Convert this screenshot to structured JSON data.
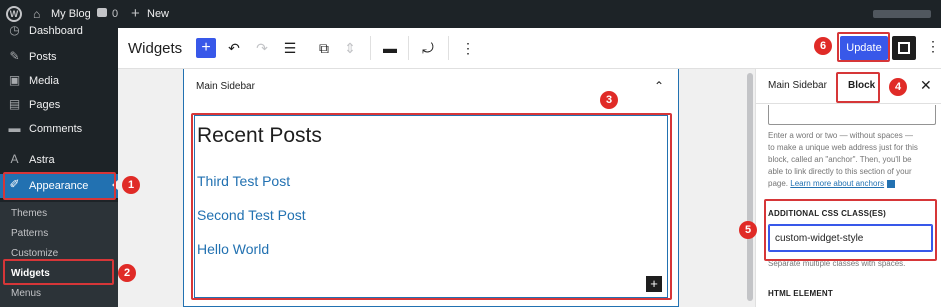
{
  "adminbar": {
    "site_name": "My Blog",
    "comment_count": "0",
    "new_label": "New",
    "wp_logo_glyph": "W",
    "home_glyph": "⌂",
    "plus_glyph": "+"
  },
  "sidebar": {
    "items": [
      {
        "label": "Dashboard",
        "icon": "dashboard-icon",
        "glyph": "◷"
      },
      {
        "label": "Posts",
        "icon": "pin-icon",
        "glyph": "✎"
      },
      {
        "label": "Media",
        "icon": "media-icon",
        "glyph": "▣"
      },
      {
        "label": "Pages",
        "icon": "pages-icon",
        "glyph": "▤"
      },
      {
        "label": "Comments",
        "icon": "comment-icon",
        "glyph": "▬"
      },
      {
        "label": "Astra",
        "icon": "astra-icon",
        "glyph": "A"
      },
      {
        "label": "Appearance",
        "icon": "brush-icon",
        "glyph": "✐"
      }
    ],
    "submenu": [
      "Themes",
      "Patterns",
      "Customize",
      "Widgets",
      "Menus"
    ]
  },
  "toolbar": {
    "title": "Widgets",
    "add_glyph": "+",
    "undo_glyph": "↶",
    "redo_glyph": "↷",
    "list_glyph": "☰",
    "copy_glyph": "⧉",
    "move_glyph": "⇕",
    "align_glyph": "▬",
    "transform_glyph": "⤾",
    "more_glyph": "⋮",
    "update_label": "Update"
  },
  "canvas": {
    "area_title": "Main Sidebar",
    "caret_glyph": "⌃",
    "block_title": "Recent Posts",
    "posts": [
      "Third Test Post",
      "Second Test Post",
      "Hello World"
    ],
    "add_glyph": "+"
  },
  "inspector": {
    "tab_main": "Main Sidebar",
    "tab_block": "Block",
    "close_glyph": "✕",
    "anchor_help_lines": [
      "Enter a word or two — without spaces —",
      "to make a unique web address just for this",
      "block, called an \"anchor\". Then, you'll be",
      "able to link directly to this section of your"
    ],
    "anchor_help_last": "page.",
    "anchor_link": "Learn more about anchors",
    "css_label": "ADDITIONAL CSS CLASS(ES)",
    "css_value": "custom-widget-style",
    "css_help": "Separate multiple classes with spaces.",
    "html_element_label": "HTML ELEMENT"
  },
  "annotations": [
    "1",
    "2",
    "3",
    "4",
    "5",
    "6"
  ],
  "colors": {
    "accent": "#3858e9",
    "admin_blue": "#2271b1",
    "highlight_red": "#d63638",
    "admin_dark": "#1d2327"
  }
}
